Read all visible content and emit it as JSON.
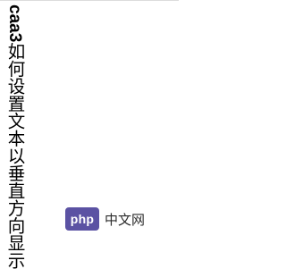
{
  "page": {
    "text_latin": "caa3",
    "text_cjk": "如何设置文本以垂直方向显示"
  },
  "watermark": {
    "logo_text": "php",
    "site_text": "中文网",
    "logo_color": "#5b52a3"
  }
}
